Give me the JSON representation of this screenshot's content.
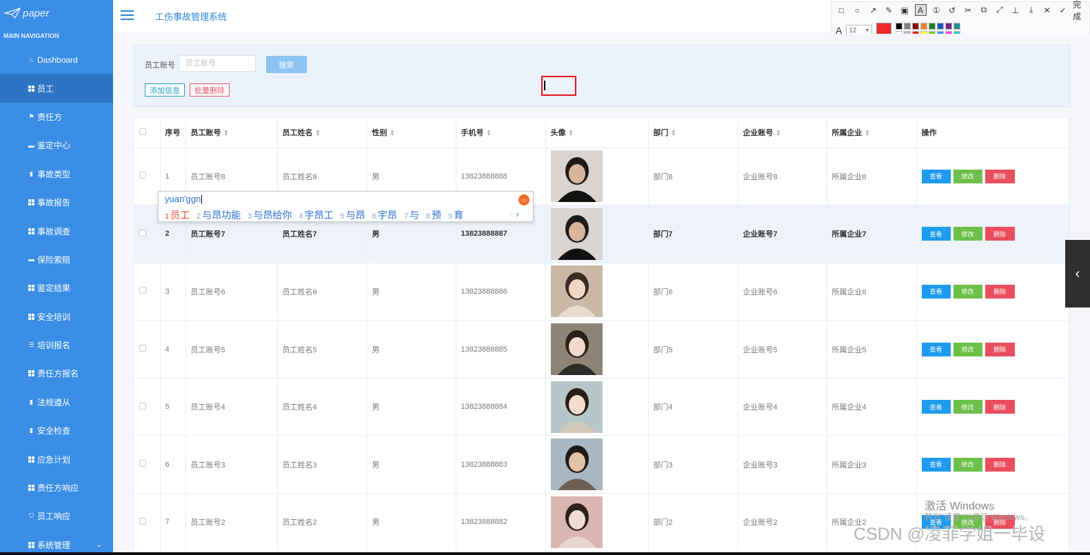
{
  "sidebar": {
    "logo": "paper",
    "nav_title": "MAIN NAVIGATION",
    "items": [
      {
        "label": "Dashboard",
        "icon": "home-icon"
      },
      {
        "label": "员工",
        "icon": "grid-icon"
      },
      {
        "label": "责任方",
        "icon": "flag-icon"
      },
      {
        "label": "鉴定中心",
        "icon": "briefcase-icon"
      },
      {
        "label": "事故类型",
        "icon": "clipboard-icon"
      },
      {
        "label": "事故报告",
        "icon": "grid-icon"
      },
      {
        "label": "事故调查",
        "icon": "grid-icon"
      },
      {
        "label": "保险索赔",
        "icon": "ticket-icon"
      },
      {
        "label": "鉴定结果",
        "icon": "grid-icon"
      },
      {
        "label": "安全培训",
        "icon": "grid-icon"
      },
      {
        "label": "培训报名",
        "icon": "list-icon"
      },
      {
        "label": "责任方报名",
        "icon": "grid-icon"
      },
      {
        "label": "法规遵从",
        "icon": "bar-chart-icon"
      },
      {
        "label": "安全检查",
        "icon": "book-icon"
      },
      {
        "label": "应急计划",
        "icon": "grid-icon"
      },
      {
        "label": "责任方响应",
        "icon": "grid-icon"
      },
      {
        "label": "员工响应",
        "icon": "shield-icon"
      },
      {
        "label": "系统管理",
        "icon": "grid-icon"
      }
    ]
  },
  "header": {
    "title": "工伤事故管理系统"
  },
  "snip_toolbar": {
    "done_label": "完成",
    "font_size": "12",
    "current_color": "#ee2a2a",
    "palette": [
      "#000000",
      "#808080",
      "#800000",
      "#f08030",
      "#208020",
      "#2050c0",
      "#802080",
      "#209090",
      "#ffffff",
      "#c0c0c0",
      "#ff2020",
      "#ffff20",
      "#80d020",
      "#4090ff",
      "#ff40ff",
      "#30d0d0"
    ]
  },
  "search": {
    "account_label": "员工账号",
    "account_placeholder": "员工账号",
    "search_button": "搜索",
    "add_button": "添加信息",
    "batch_delete_button": "批量删除"
  },
  "table": {
    "columns": [
      "序号",
      "员工账号",
      "员工姓名",
      "性别",
      "手机号",
      "头像",
      "部门",
      "企业账号",
      "所属企业",
      "操作"
    ],
    "rows": [
      {
        "idx": "1",
        "acct": "员工账号8",
        "name": "员工姓名8",
        "gender": "男",
        "phone": "13823888888",
        "dept": "部门8",
        "corp_acct": "企业账号8",
        "corp": "所属企业8"
      },
      {
        "idx": "2",
        "acct": "员工账号7",
        "name": "员工姓名7",
        "gender": "男",
        "phone": "13823888887",
        "dept": "部门7",
        "corp_acct": "企业账号7",
        "corp": "所属企业7"
      },
      {
        "idx": "3",
        "acct": "员工账号6",
        "name": "员工姓名6",
        "gender": "男",
        "phone": "13823888886",
        "dept": "部门6",
        "corp_acct": "企业账号6",
        "corp": "所属企业6"
      },
      {
        "idx": "4",
        "acct": "员工账号5",
        "name": "员工姓名5",
        "gender": "男",
        "phone": "13823888885",
        "dept": "部门5",
        "corp_acct": "企业账号5",
        "corp": "所属企业5"
      },
      {
        "idx": "5",
        "acct": "员工账号4",
        "name": "员工姓名4",
        "gender": "男",
        "phone": "13823888884",
        "dept": "部门4",
        "corp_acct": "企业账号4",
        "corp": "所属企业4"
      },
      {
        "idx": "6",
        "acct": "员工账号3",
        "name": "员工姓名3",
        "gender": "男",
        "phone": "13823888883",
        "dept": "部门3",
        "corp_acct": "企业账号3",
        "corp": "所属企业3"
      },
      {
        "idx": "7",
        "acct": "员工账号2",
        "name": "员工姓名2",
        "gender": "男",
        "phone": "13823888882",
        "dept": "部门2",
        "corp_acct": "企业账号2",
        "corp": "所属企业2"
      }
    ],
    "actions": {
      "view": "查看",
      "edit": "修改",
      "delete": "删除"
    }
  },
  "ime": {
    "pinyin": "yuan'ggn",
    "candidates": [
      {
        "n": "1",
        "text": "员工"
      },
      {
        "n": "2",
        "text": "与昂功能"
      },
      {
        "n": "3",
        "text": "与昂给你"
      },
      {
        "n": "4",
        "text": "宇昂工"
      },
      {
        "n": "5",
        "text": "与昂"
      },
      {
        "n": "6",
        "text": "宇昂"
      },
      {
        "n": "7",
        "text": "与"
      },
      {
        "n": "8",
        "text": "预"
      },
      {
        "n": "9",
        "text": "育"
      }
    ]
  },
  "watermarks": {
    "windows_title": "激活 Windows",
    "windows_sub": "转到\"设置\"以激活 Windows。",
    "csdn": "CSDN @凌菲学姐一毕设"
  }
}
